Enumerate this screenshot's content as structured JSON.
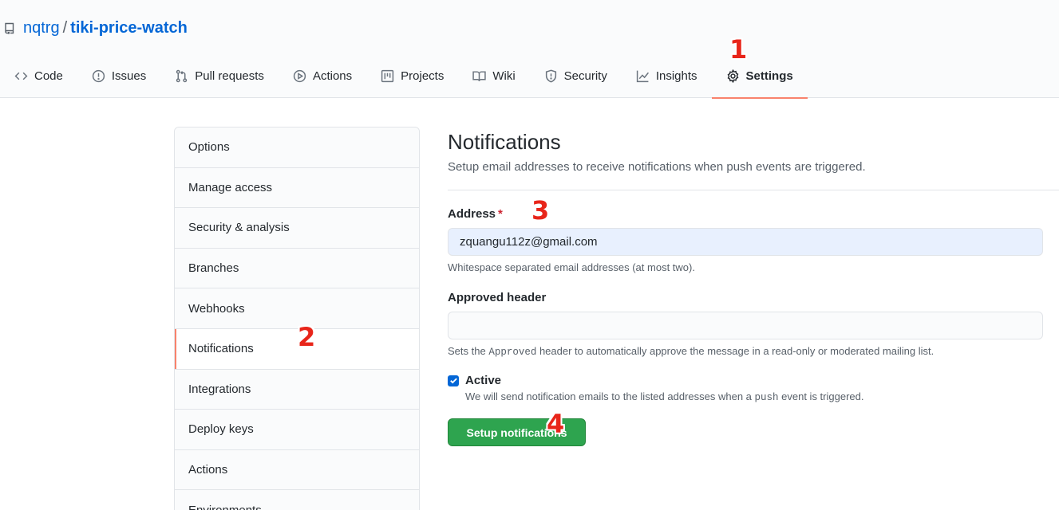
{
  "repo": {
    "owner": "nqtrg",
    "separator": "/",
    "name": "tiki-price-watch"
  },
  "tabs": [
    {
      "label": "Code",
      "icon": "code-icon"
    },
    {
      "label": "Issues",
      "icon": "issue-icon"
    },
    {
      "label": "Pull requests",
      "icon": "pull-request-icon"
    },
    {
      "label": "Actions",
      "icon": "play-icon"
    },
    {
      "label": "Projects",
      "icon": "project-icon"
    },
    {
      "label": "Wiki",
      "icon": "book-icon"
    },
    {
      "label": "Security",
      "icon": "shield-icon"
    },
    {
      "label": "Insights",
      "icon": "graph-icon"
    },
    {
      "label": "Settings",
      "icon": "gear-icon",
      "selected": true
    }
  ],
  "sidebar": {
    "items": [
      {
        "label": "Options"
      },
      {
        "label": "Manage access"
      },
      {
        "label": "Security & analysis"
      },
      {
        "label": "Branches"
      },
      {
        "label": "Webhooks"
      },
      {
        "label": "Notifications",
        "selected": true
      },
      {
        "label": "Integrations"
      },
      {
        "label": "Deploy keys"
      },
      {
        "label": "Actions"
      },
      {
        "label": "Environments"
      }
    ]
  },
  "main": {
    "title": "Notifications",
    "description": "Setup email addresses to receive notifications when push events are triggered.",
    "address": {
      "label": "Address",
      "required_mark": "*",
      "value": "zquangu112z@gmail.com",
      "note": "Whitespace separated email addresses (at most two)."
    },
    "approved_header": {
      "label": "Approved header",
      "value": "",
      "note_prefix": "Sets the ",
      "note_code": "Approved",
      "note_suffix": " header to automatically approve the message in a read-only or moderated mailing list."
    },
    "active": {
      "label": "Active",
      "checked": true,
      "note_prefix": "We will send notification emails to the listed addresses when a ",
      "note_code": "push",
      "note_suffix": " event is triggered."
    },
    "submit_label": "Setup notifications"
  },
  "markers": [
    "1",
    "2",
    "3",
    "4"
  ],
  "colors": {
    "link": "#0366d6",
    "selected_underline": "#f9826c",
    "primary_button": "#2ea44f",
    "marker": "#e8251a",
    "checkbox": "#0366d6"
  }
}
